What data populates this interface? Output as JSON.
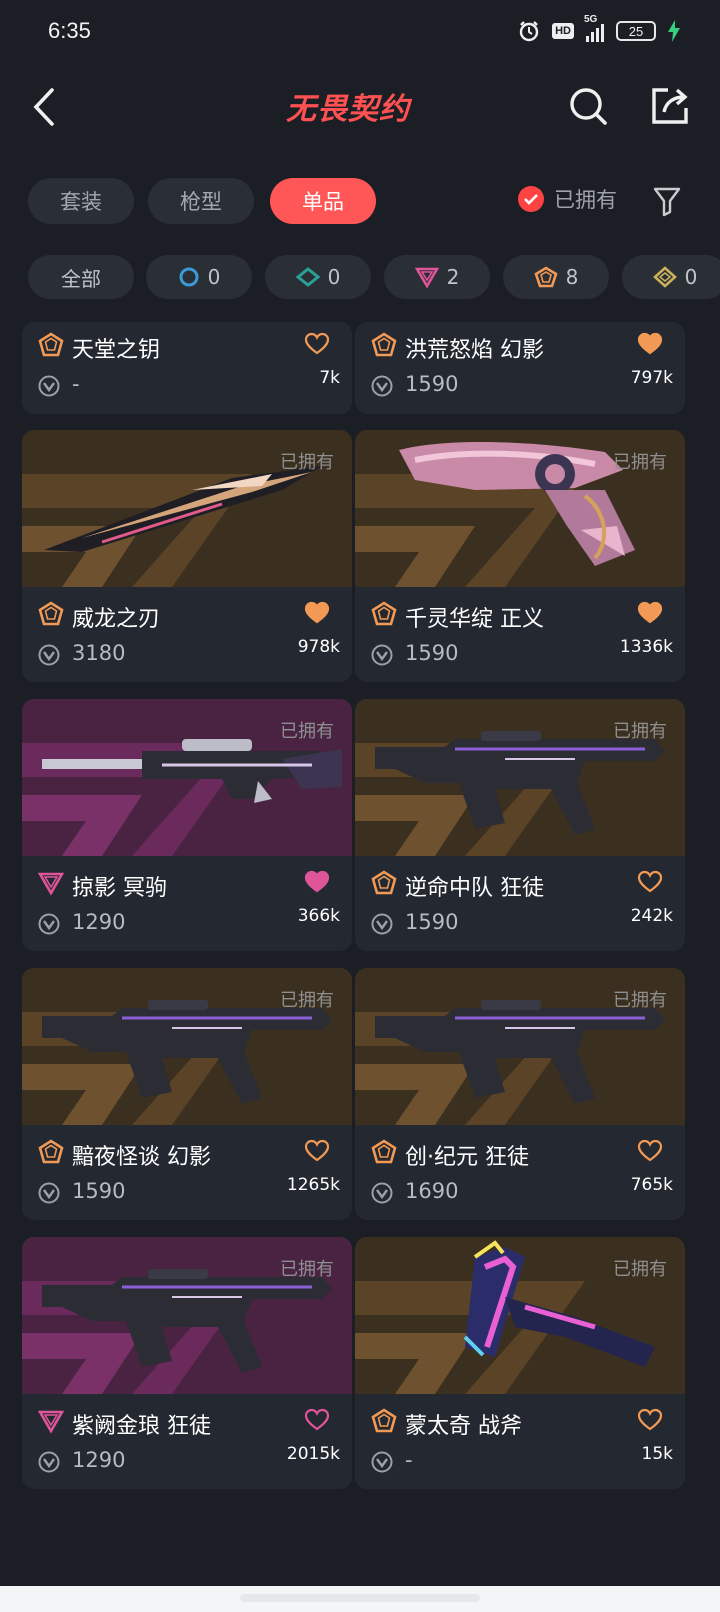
{
  "status_bar": {
    "time": "6:35",
    "hd": "HD",
    "network": "5G",
    "battery": "25"
  },
  "header": {
    "logo": "无畏契约"
  },
  "tabs": [
    {
      "label": "套装",
      "active": false
    },
    {
      "label": "枪型",
      "active": false
    },
    {
      "label": "单品",
      "active": true
    }
  ],
  "owned_filter": {
    "label": "已拥有",
    "checked": true
  },
  "rarity_chips": [
    {
      "label": "全部"
    },
    {
      "count": "0",
      "icon": "select-tier-icon",
      "color": "#3b9bd8"
    },
    {
      "count": "0",
      "icon": "deluxe-tier-icon",
      "color": "#2aa198"
    },
    {
      "count": "2",
      "icon": "premium-tier-icon",
      "color": "#e0559a"
    },
    {
      "count": "8",
      "icon": "exclusive-tier-icon",
      "color": "#f29a55"
    },
    {
      "count": "0",
      "icon": "ultra-tier-icon",
      "color": "#c9b05b"
    }
  ],
  "cards": [
    {
      "name": "天堂之钥",
      "price": "-",
      "likes": "7k",
      "liked": false,
      "rarity": "exclusive",
      "owned": "",
      "theme": "gold",
      "weapon": "knife"
    },
    {
      "name": "洪荒怒焰 幻影",
      "price": "1590",
      "likes": "797k",
      "liked": true,
      "rarity": "exclusive",
      "owned": "",
      "theme": "gold",
      "weapon": "rifle"
    },
    {
      "name": "威龙之刃",
      "price": "3180",
      "likes": "978k",
      "liked": true,
      "rarity": "exclusive",
      "owned": "已拥有",
      "theme": "gold",
      "weapon": "knife"
    },
    {
      "name": "千灵华绽 正义",
      "price": "1590",
      "likes": "1336k",
      "liked": true,
      "rarity": "exclusive",
      "owned": "已拥有",
      "theme": "gold",
      "weapon": "pistol"
    },
    {
      "name": "掠影 冥驹",
      "price": "1290",
      "likes": "366k",
      "liked": true,
      "rarity": "premium",
      "owned": "已拥有",
      "theme": "magenta",
      "weapon": "sniper"
    },
    {
      "name": "逆命中队 狂徒",
      "price": "1590",
      "likes": "242k",
      "liked": false,
      "rarity": "exclusive",
      "owned": "已拥有",
      "theme": "gold",
      "weapon": "rifle"
    },
    {
      "name": "黯夜怪谈 幻影",
      "price": "1590",
      "likes": "1265k",
      "liked": false,
      "rarity": "exclusive",
      "owned": "已拥有",
      "theme": "gold",
      "weapon": "rifle"
    },
    {
      "name": "创·纪元 狂徒",
      "price": "1690",
      "likes": "765k",
      "liked": false,
      "rarity": "exclusive",
      "owned": "已拥有",
      "theme": "gold",
      "weapon": "rifle"
    },
    {
      "name": "紫阙金琅 狂徒",
      "price": "1290",
      "likes": "2015k",
      "liked": false,
      "rarity": "premium",
      "owned": "已拥有",
      "theme": "magenta",
      "weapon": "rifle"
    },
    {
      "name": "蒙太奇 战斧",
      "price": "-",
      "likes": "15k",
      "liked": false,
      "rarity": "exclusive",
      "owned": "已拥有",
      "theme": "gold",
      "weapon": "axe"
    }
  ],
  "colors": {
    "accent": "#ff5757",
    "exclusive": "#f29a55",
    "premium": "#e0559a",
    "background": "#1b1e24",
    "card": "#232831"
  }
}
